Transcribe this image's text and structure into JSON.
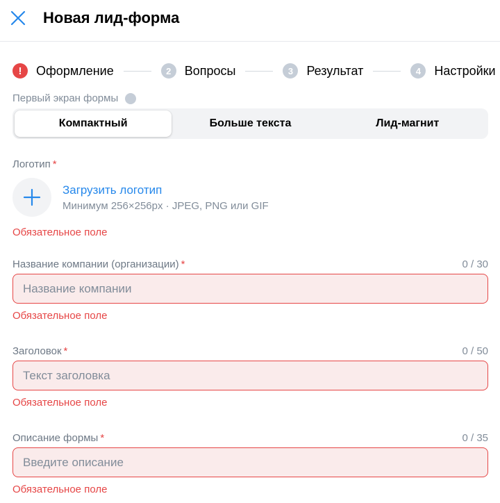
{
  "header": {
    "title": "Новая лид-форма",
    "close_icon": "close-icon"
  },
  "stepper": {
    "steps": [
      {
        "marker": "!",
        "label": "Оформление",
        "state": "error"
      },
      {
        "marker": "2",
        "label": "Вопросы",
        "state": "inactive"
      },
      {
        "marker": "3",
        "label": "Результат",
        "state": "inactive"
      },
      {
        "marker": "4",
        "label": "Настройки",
        "state": "inactive"
      }
    ]
  },
  "first_screen": {
    "label": "Первый экран формы",
    "options": [
      {
        "label": "Компактный",
        "selected": true
      },
      {
        "label": "Больше текста",
        "selected": false
      },
      {
        "label": "Лид-магнит",
        "selected": false
      }
    ]
  },
  "logo": {
    "label": "Логотип",
    "required_mark": "*",
    "upload_label": "Загрузить логотип",
    "hint": "Минимум 256×256px · JPEG, PNG или GIF",
    "error": "Обязательное поле"
  },
  "company": {
    "label": "Название компании (организации)",
    "required_mark": "*",
    "counter": "0 / 30",
    "placeholder": "Название компании",
    "value": "",
    "error": "Обязательное поле"
  },
  "heading": {
    "label": "Заголовок",
    "required_mark": "*",
    "counter": "0 / 50",
    "placeholder": "Текст заголовка",
    "value": "",
    "error": "Обязательное поле"
  },
  "description": {
    "label": "Описание формы",
    "required_mark": "*",
    "counter": "0 / 35",
    "placeholder": "Введите описание",
    "value": "",
    "error": "Обязательное поле"
  },
  "colors": {
    "accent": "#2688eb",
    "error": "#e64646",
    "error_bg": "#faebeb",
    "secondary_text": "#818c99"
  }
}
